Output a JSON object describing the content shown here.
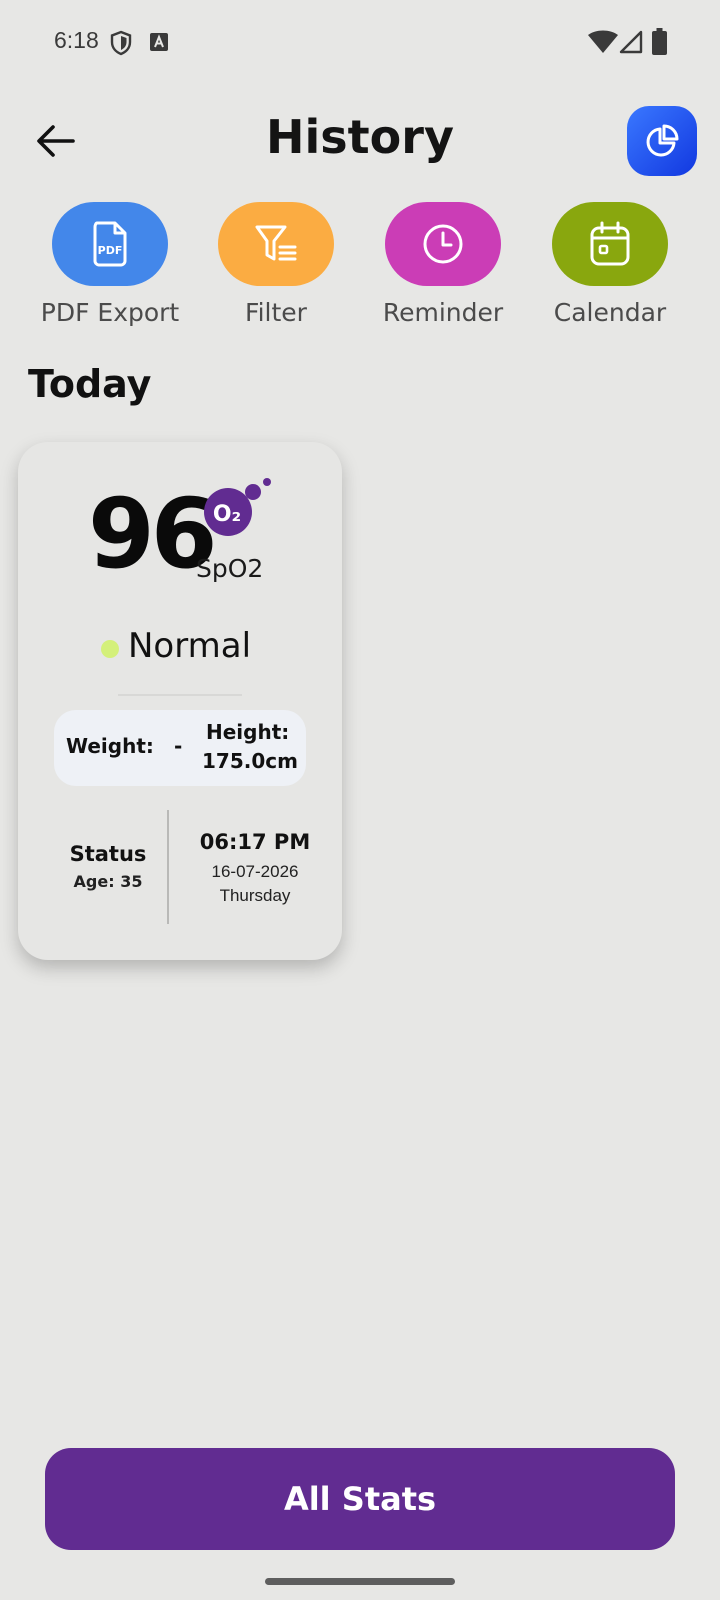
{
  "status_bar": {
    "time": "6:18"
  },
  "header": {
    "title": "History",
    "icons": {
      "back": "arrow-left-icon",
      "chart": "pie-chart-icon"
    }
  },
  "actions": [
    {
      "label": "PDF Export",
      "icon": "pdf-file-icon",
      "color": "#4387ea"
    },
    {
      "label": "Filter",
      "icon": "filter-list-icon",
      "color": "#fbac42"
    },
    {
      "label": "Reminder",
      "icon": "clock-icon",
      "color": "#cb3db6"
    },
    {
      "label": "Calendar",
      "icon": "calendar-icon",
      "color": "#89a70e"
    }
  ],
  "section": {
    "title": "Today"
  },
  "record": {
    "value": "96",
    "badge": "O₂",
    "unit": "SpO2",
    "status": "Normal",
    "status_color": "#d4f07a",
    "weight_label": "Weight:",
    "weight_value": "-",
    "height_label": "Height:",
    "height_value": "175.0cm",
    "status_title": "Status",
    "age": "Age: 35",
    "time": "06:17 PM",
    "date": "16-07-2026",
    "day": "Thursday"
  },
  "footer": {
    "button_label": "All Stats",
    "button_color": "#612c91"
  }
}
